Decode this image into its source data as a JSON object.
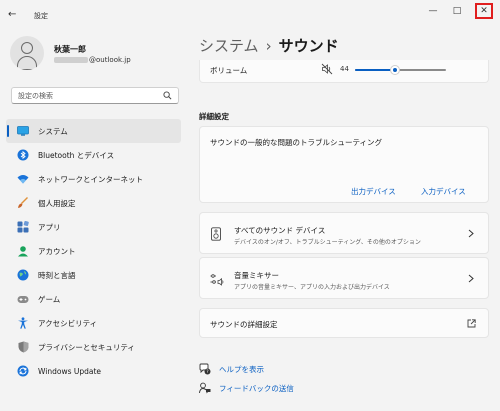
{
  "app": {
    "title": "設定",
    "back_glyph": "←"
  },
  "window_controls": {
    "minimize": "—",
    "maximize": "□",
    "close": "✕"
  },
  "user": {
    "name": "秋葉一郎",
    "email_domain": "@outlook.jp"
  },
  "search": {
    "placeholder": "設定の検索"
  },
  "nav": {
    "items": [
      {
        "label": "システム",
        "icon": "system-icon",
        "active": true
      },
      {
        "label": "Bluetooth とデバイス",
        "icon": "bluetooth-icon"
      },
      {
        "label": "ネットワークとインターネット",
        "icon": "wifi-icon"
      },
      {
        "label": "個人用設定",
        "icon": "brush-icon"
      },
      {
        "label": "アプリ",
        "icon": "apps-icon"
      },
      {
        "label": "アカウント",
        "icon": "account-icon"
      },
      {
        "label": "時刻と言語",
        "icon": "globe-icon"
      },
      {
        "label": "ゲーム",
        "icon": "gamepad-icon"
      },
      {
        "label": "アクセシビリティ",
        "icon": "accessibility-icon"
      },
      {
        "label": "プライバシーとセキュリティ",
        "icon": "shield-icon"
      },
      {
        "label": "Windows Update",
        "icon": "update-icon"
      }
    ]
  },
  "breadcrumb": {
    "parent": "システム",
    "separator": "›",
    "current": "サウンド"
  },
  "volume": {
    "label": "ボリューム",
    "value": "44",
    "level_percent": 44
  },
  "advanced": {
    "heading": "詳細設定",
    "troubleshoot": {
      "title": "サウンドの一般的な問題のトラブルシューティング",
      "output_btn": "出力デバイス",
      "input_btn": "入力デバイス"
    },
    "all_devices": {
      "title": "すべてのサウンド デバイス",
      "desc": "デバイスのオン/オフ、トラブルシューティング、その他のオプション"
    },
    "mixer": {
      "title": "音量ミキサー",
      "desc": "アプリの音量ミキサー、アプリの入力および出力デバイス"
    },
    "more_settings": {
      "title": "サウンドの詳細設定"
    }
  },
  "footer": {
    "help": "ヘルプを表示",
    "feedback": "フィードバックの送信"
  },
  "colors": {
    "accent": "#0a5fc2",
    "close_highlight": "#e01e1e",
    "background": "#f3f3f3"
  }
}
